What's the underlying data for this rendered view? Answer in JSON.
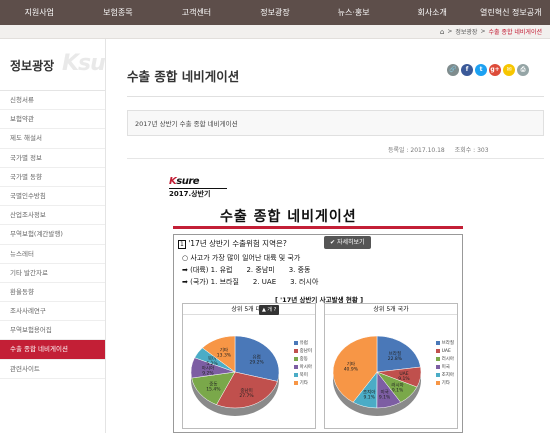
{
  "top_nav": [
    "지원사업",
    "보험종목",
    "고객센터",
    "정보광장",
    "뉴스·홍보",
    "회사소개",
    "열린혁신 정보공개"
  ],
  "breadcrumb": {
    "home_icon": "home-icon",
    "section": "정보광장",
    "current": "수출 종합 네비게이션"
  },
  "sidebar": {
    "title": "정보광장",
    "logo": "Ksure",
    "items": [
      "신청서류",
      "보험약관",
      "제도 해설서",
      "국가별 정보",
      "국가별 동향",
      "국별인수방침",
      "산업조사정보",
      "무역보험(계간발행)",
      "뉴스레터",
      "기타 발간자료",
      "환율동향",
      "조사사례연구",
      "무역보험용어집",
      "수출 종합 네비게이션",
      "관련사이트"
    ],
    "active_index": 13
  },
  "page": {
    "title": "수출 종합 네비게이션",
    "article_title": "2017년 상반기 수출 종합 네비게이션",
    "date_label": "등록일 : 2017.10.18",
    "views_label": "조회수 : 303"
  },
  "share": {
    "buttons": [
      "link-icon",
      "facebook-icon",
      "twitter-icon",
      "google-plus-icon",
      "kakao-icon",
      "print-icon"
    ],
    "colors": [
      "#7f8c8d",
      "#3b5998",
      "#1da1f2",
      "#dd4b39",
      "#f7c600",
      "#95a5a6"
    ]
  },
  "content": {
    "logo": "Ksure",
    "logo_sub": "2017.상반기",
    "heading": "수출 종합 네비게이션",
    "question": "'17년 상반기 수출위험 지역은?",
    "detail_button": "자세히보기",
    "line1": "사고가 가장 많이 일어난 대륙 및 국가",
    "line2_label": "(대륙)",
    "line2_items": [
      "1. 유럽",
      "2. 중남미",
      "3. 중동"
    ],
    "line3_label": "(국가)",
    "line3_items": [
      "1. 브라질",
      "2. UAE",
      "3. 러시아"
    ],
    "subtitle": "[ '17년 상반기 사고발생 현황 ]",
    "overlay": "▲ 개 ?",
    "left_panel_title": "상위 5개 대륙",
    "right_panel_title": "상위 5개 국가",
    "left_legend": [
      "유럽",
      "중남미",
      "중동",
      "아시아",
      "북미",
      "기타"
    ],
    "right_legend": [
      "브라질",
      "UAE",
      "러시아",
      "미국",
      "조지아",
      "기타"
    ]
  },
  "chart_data": [
    {
      "type": "pie",
      "title": "상위 5개 대륙",
      "categories": [
        "유럽",
        "중남미",
        "중동",
        "아시아",
        "북미",
        "기타"
      ],
      "values": [
        29.2,
        27.7,
        15.4,
        9.2,
        5.2,
        13.3
      ],
      "colors": [
        "#4a78b8",
        "#c0504d",
        "#7aa84a",
        "#7d5ea3",
        "#4bacc6",
        "#f79646"
      ]
    },
    {
      "type": "pie",
      "title": "상위 5개 국가",
      "categories": [
        "브라질",
        "UAE",
        "러시아",
        "미국",
        "조지아",
        "기타"
      ],
      "values": [
        22.8,
        9.1,
        9.1,
        9.1,
        9.1,
        40.9
      ],
      "colors": [
        "#4a78b8",
        "#c0504d",
        "#7aa84a",
        "#7d5ea3",
        "#4bacc6",
        "#f79646"
      ]
    }
  ]
}
